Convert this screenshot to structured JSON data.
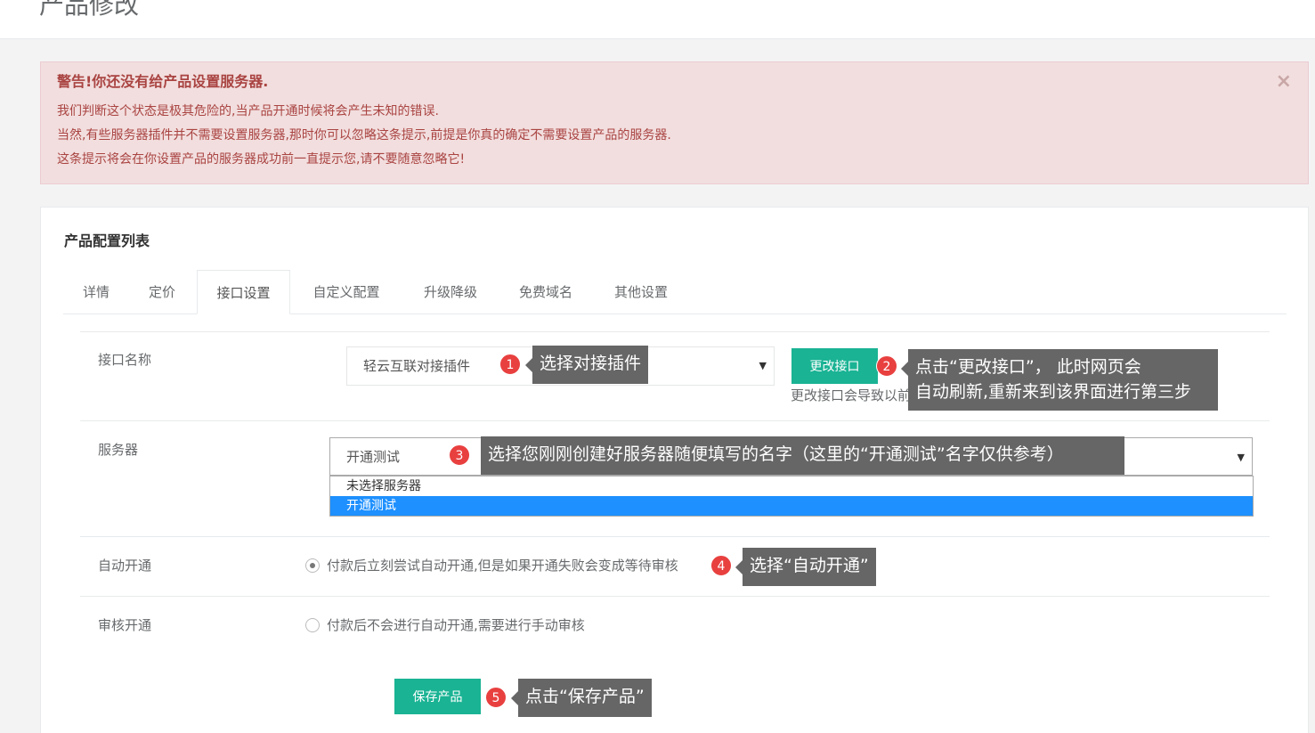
{
  "page": {
    "title": "产品修改"
  },
  "alert": {
    "title": "警告!你还没有给产品设置服务器.",
    "lines": [
      "我们判断这个状态是极其危险的,当产品开通时候将会产生未知的错误.",
      "当然,有些服务器插件并不需要设置服务器,那时你可以忽略这条提示,前提是你真的确定不需要设置产品的服务器.",
      "这条提示将会在你设置产品的服务器成功前一直提示您,请不要随意忽略它!"
    ],
    "close": "×"
  },
  "panel": {
    "title": "产品配置列表"
  },
  "tabs": [
    {
      "label": "详情"
    },
    {
      "label": "定价"
    },
    {
      "label": "接口设置"
    },
    {
      "label": "自定义配置"
    },
    {
      "label": "升级降级"
    },
    {
      "label": "免费域名"
    },
    {
      "label": "其他设置"
    }
  ],
  "form": {
    "interface_label": "接口名称",
    "interface_value": "轻云互联对接插件",
    "change_button": "更改接口",
    "change_hint": "更改接口会导致以前",
    "server_label": "服务器",
    "server_value": "开通测试",
    "server_options": [
      "未选择服务器",
      "开通测试"
    ],
    "auto_label": "自动开通",
    "auto_option": "付款后立刻尝试自动开通,但是如果开通失败会变成等待审核",
    "review_label": "审核开通",
    "review_option": "付款后不会进行自动开通,需要进行手动审核",
    "save_button": "保存产品",
    "caret": "▼"
  },
  "annotations": [
    {
      "num": "1",
      "text": "选择对接插件"
    },
    {
      "num": "2",
      "text": "点击“更改接口”， 此时网页会",
      "text2": "自动刷新,重新来到该界面进行第三步"
    },
    {
      "num": "3",
      "text": "选择您刚刚创建好服务器随便填写的名字（这里的“开通测试”名字仅供参考）"
    },
    {
      "num": "4",
      "text": "选择“自动开通”"
    },
    {
      "num": "5",
      "text": "点击“保存产品”"
    }
  ]
}
